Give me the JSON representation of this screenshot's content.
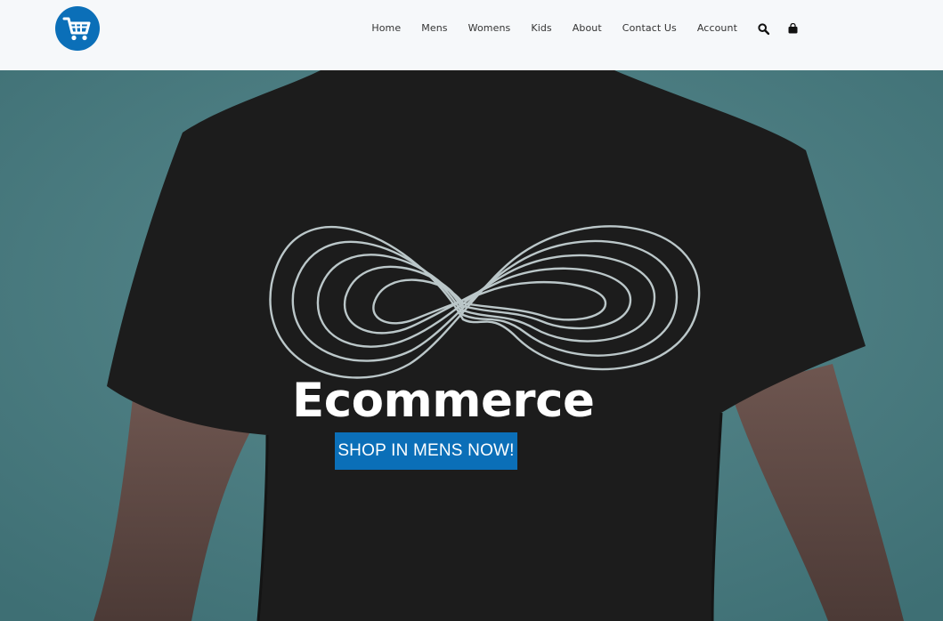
{
  "brand": {
    "logo_icon": "shopping-cart-icon",
    "accent": "#0b6fb8"
  },
  "nav": {
    "items": [
      {
        "label": "Home"
      },
      {
        "label": "Mens"
      },
      {
        "label": "Womens"
      },
      {
        "label": "Kids"
      },
      {
        "label": "About"
      },
      {
        "label": "Contact Us"
      },
      {
        "label": "Account"
      }
    ],
    "search_icon": "search-icon",
    "bag_icon": "shopping-bag-icon"
  },
  "hero": {
    "title": "Ecommerce",
    "cta_label": "SHOP IN MENS NOW!",
    "background": "#4d7d82"
  }
}
